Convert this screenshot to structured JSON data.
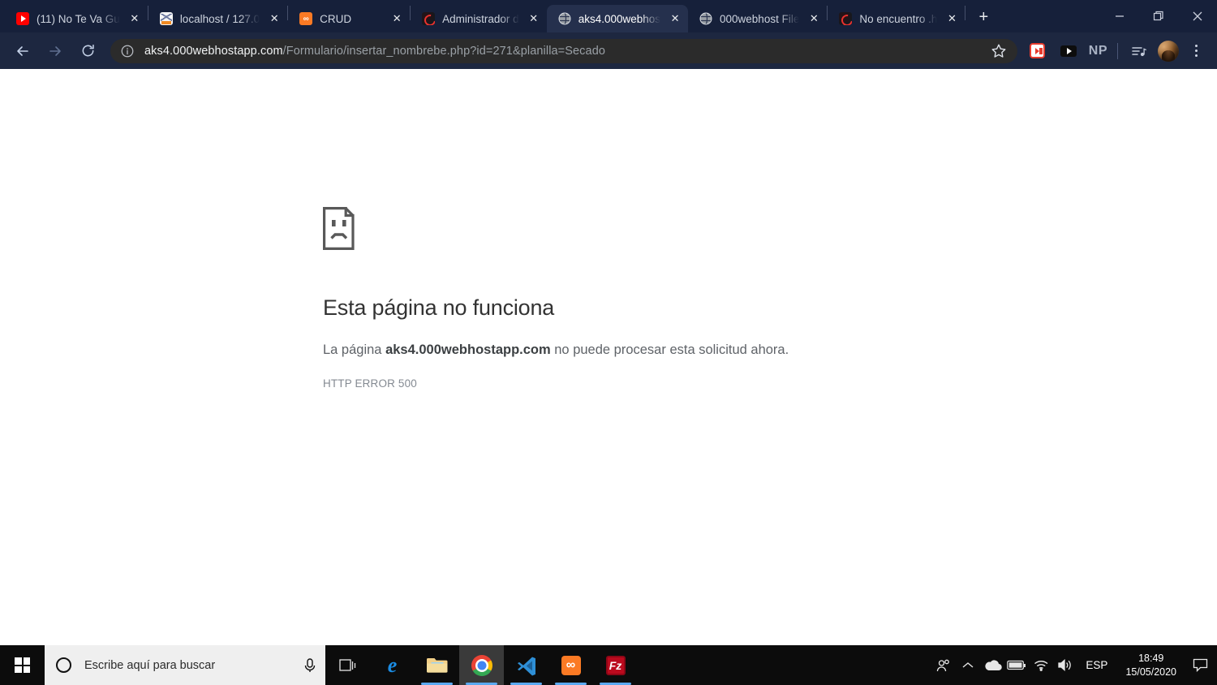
{
  "window": {
    "minimize_label": "Minimizar",
    "restore_label": "Restaurar",
    "close_label": "Cerrar"
  },
  "tabs": [
    {
      "title": "(11) No Te Va Gu",
      "favicon": "youtube-icon",
      "active": false
    },
    {
      "title": "localhost / 127.0",
      "favicon": "phpmyadmin-icon",
      "active": false
    },
    {
      "title": "CRUD",
      "favicon": "xampp-icon",
      "active": false
    },
    {
      "title": "Administrador d",
      "favicon": "000webhost-icon",
      "active": false
    },
    {
      "title": "aks4.000webhos",
      "favicon": "globe-icon",
      "active": true
    },
    {
      "title": "000webhost File",
      "favicon": "globe-icon",
      "active": false
    },
    {
      "title": "No encuentro .h",
      "favicon": "000webhost-icon",
      "active": false
    }
  ],
  "tab_close_label": "✕",
  "new_tab_label": "+",
  "toolbar": {
    "back_label": "back-arrow-icon",
    "forward_label": "forward-arrow-icon",
    "reload_label": "reload-icon",
    "site_info_label": "site-information-icon",
    "url_host": "aks4.000webhostapp.com",
    "url_path": "/Formulario/insertar_nombrebe.php?id=271&planilla=Secado",
    "bookmark_label": "bookmark-star-icon",
    "extension_fastforward": "fast-forward-extension-icon",
    "extension_youtube": "youtube-extension-icon",
    "profile_initials": "NP",
    "media_icon_label": "media-playlist-icon",
    "avatar_label": "user-avatar",
    "menu_label": "chrome-menu-icon"
  },
  "error_page": {
    "icon": "sad-page-icon",
    "title": "Esta página no funciona",
    "message_prefix": "La página ",
    "message_domain": "aks4.000webhostapp.com",
    "message_suffix": " no puede procesar esta solicitud ahora.",
    "code": "HTTP ERROR 500"
  },
  "taskbar": {
    "start_label": "windows-start-icon",
    "search_placeholder": "Escribe aquí para buscar",
    "cortana_label": "cortana-icon",
    "mic_label": "microphone-icon",
    "apps": [
      {
        "name": "task-view",
        "label": "Vista de tareas",
        "running": false,
        "active": false
      },
      {
        "name": "edge",
        "label": "Microsoft Edge",
        "glyph": "e",
        "running": false,
        "active": false
      },
      {
        "name": "file-explorer",
        "label": "Explorador de archivos",
        "running": true,
        "active": false
      },
      {
        "name": "chrome",
        "label": "Google Chrome",
        "running": true,
        "active": true
      },
      {
        "name": "vscode",
        "label": "Visual Studio Code",
        "running": true,
        "active": false
      },
      {
        "name": "xampp",
        "label": "XAMPP Control Panel",
        "glyph": "∞",
        "running": true,
        "active": false
      },
      {
        "name": "filezilla",
        "label": "FileZilla",
        "glyph": "Fz",
        "running": true,
        "active": false
      }
    ],
    "tray": {
      "people_label": "people-icon",
      "chevron_label": "show-hidden-icons-icon",
      "onedrive_label": "onedrive-cloud-icon",
      "battery_label": "battery-icon",
      "network_label": "wifi-icon",
      "volume_label": "volume-icon",
      "language": "ESP",
      "time": "18:49",
      "date": "15/05/2020",
      "notifications_label": "action-center-icon"
    }
  },
  "colors": {
    "tabstrip_bg": "#16203a",
    "toolbar_bg": "#1d2740",
    "active_tab_bg": "#25304d",
    "omnibox_bg": "#2b2b2b",
    "page_bg": "#ffffff",
    "taskbar_bg": "#0c0c0c",
    "accent": "#5aa9f0"
  }
}
